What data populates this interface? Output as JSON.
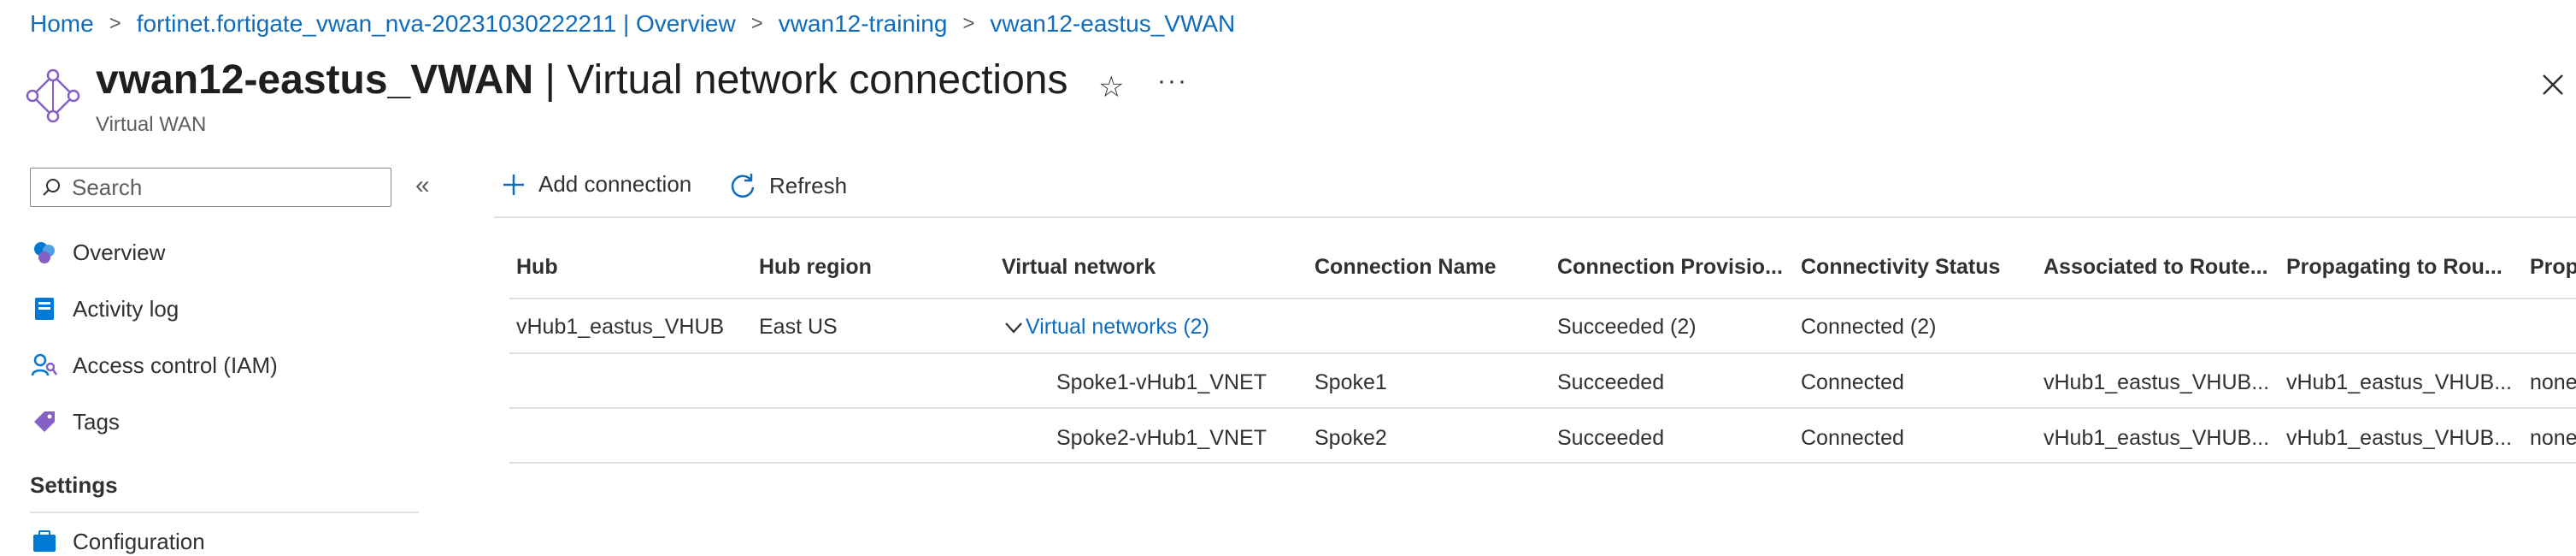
{
  "breadcrumb": [
    {
      "label": "Home"
    },
    {
      "label": "fortinet.fortigate_vwan_nva-20231030222211 | Overview"
    },
    {
      "label": "vwan12-training"
    },
    {
      "label": "vwan12-eastus_VWAN"
    }
  ],
  "header": {
    "title_resource": "vwan12-eastus_VWAN",
    "title_page": "| Virtual network connections",
    "subtitle": "Virtual WAN",
    "favorite_icon": "star-icon",
    "more_icon": "more-icon",
    "close_icon": "close-icon"
  },
  "sidebar": {
    "search": {
      "placeholder": "Search",
      "value": ""
    },
    "items": [
      {
        "label": "Overview",
        "icon": "overview-icon"
      },
      {
        "label": "Activity log",
        "icon": "activity-log-icon"
      },
      {
        "label": "Access control (IAM)",
        "icon": "access-control-icon"
      },
      {
        "label": "Tags",
        "icon": "tag-icon"
      }
    ],
    "settings_header": "Settings",
    "settings_items": [
      {
        "label": "Configuration",
        "icon": "configuration-icon"
      }
    ]
  },
  "toolbar": {
    "add_label": "Add connection",
    "refresh_label": "Refresh"
  },
  "table": {
    "columns": [
      "Hub",
      "Hub region",
      "Virtual network",
      "Connection Name",
      "Connection Provisio...",
      "Connectivity Status",
      "Associated to Route...",
      "Propagating to Rou...",
      "Prop"
    ],
    "group_row": {
      "hub": "vHub1_eastus_VHUB",
      "hub_region": "East US",
      "virtual_network": "Virtual networks (2)",
      "provisioning": "Succeeded (2)",
      "connectivity": "Connected (2)"
    },
    "rows": [
      {
        "virtual_network": "Spoke1-vHub1_VNET",
        "connection_name": "Spoke1",
        "provisioning": "Succeeded",
        "connectivity": "Connected",
        "associated": "vHub1_eastus_VHUB...",
        "propagating": "vHub1_eastus_VHUB...",
        "prop": "none"
      },
      {
        "virtual_network": "Spoke2-vHub1_VNET",
        "connection_name": "Spoke2",
        "provisioning": "Succeeded",
        "connectivity": "Connected",
        "associated": "vHub1_eastus_VHUB...",
        "propagating": "vHub1_eastus_VHUB...",
        "prop": "none"
      }
    ]
  },
  "colors": {
    "link": "#0f6cbd",
    "text": "#323130",
    "muted": "#605e5c",
    "divider": "#e1dfdd"
  }
}
